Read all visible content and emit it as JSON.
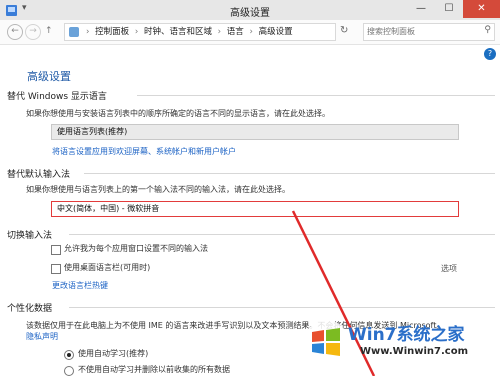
{
  "window": {
    "title": "高级设置",
    "controls": {
      "minimize": "—",
      "maximize": "☐",
      "close": "✕"
    }
  },
  "nav": {
    "back_glyph": "←",
    "forward_glyph": "→",
    "up_glyph": "↑",
    "breadcrumbs": [
      "控制面板",
      "时钟、语言和区域",
      "语言",
      "高级设置"
    ],
    "refresh_glyph": "↻",
    "search_placeholder": "搜索控制面板",
    "help_glyph": "?"
  },
  "page": {
    "title": "高级设置",
    "display_language": {
      "heading": "替代 Windows 显示语言",
      "description": "如果你想使用与安装语言列表中的顺序所确定的语言不同的显示语言，请在此处选择。",
      "selected": "使用语言列表(推荐)",
      "apply_link": "将语言设置应用到欢迎屏幕、系统帐户和新用户帐户"
    },
    "input_method": {
      "heading": "替代默认输入法",
      "description": "如果你想使用与语言列表上的第一个输入法不同的输入法，请在此处选择。",
      "selected": "中文(简体，中国) - 微软拼音"
    },
    "switching": {
      "heading": "切换输入法",
      "checkbox1": "允许我为每个应用窗口设置不同的输入法",
      "checkbox2": "使用桌面语言栏(可用时)",
      "options_link": "选项",
      "hotkeys_link": "更改语言栏热键"
    },
    "personalization": {
      "heading": "个性化数据",
      "description": "该数据仅用于在此电脑上为不使用 IME 的语言来改进手写识别以及文本预测结果。不会将任何信息发送到 Microsoft。",
      "privacy_link": "隐私声明",
      "radio1": "使用自动学习(推荐)",
      "radio2": "不使用自动学习并删除以前收集的所有数据"
    }
  },
  "watermark": {
    "brand": "Win7系统之家",
    "url": "Www.Winwin7.com"
  },
  "colors": {
    "accent": "#1f5aa6",
    "link": "#1b62c4",
    "highlight_border": "#e23b3b",
    "annotation_line": "#e02a2a",
    "close_button": "#d44a3a"
  }
}
